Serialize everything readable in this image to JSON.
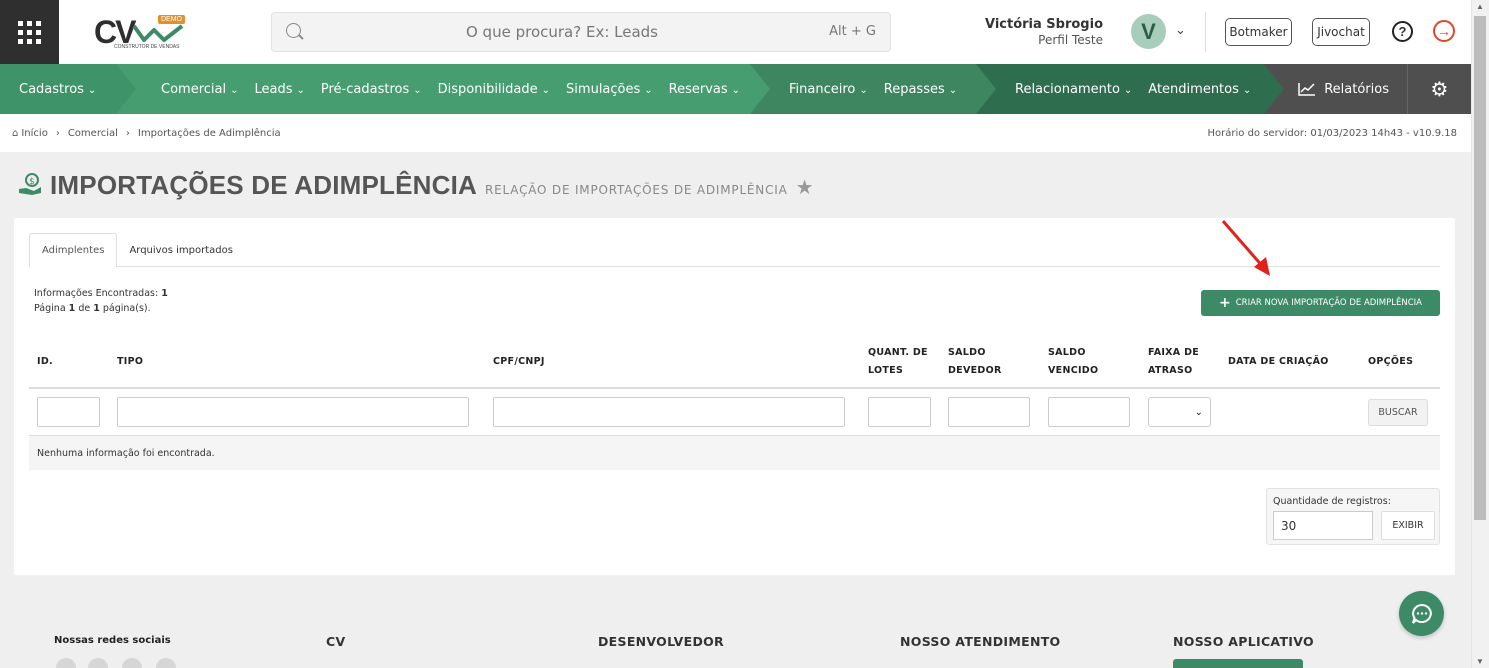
{
  "header": {
    "logo_text": "CV",
    "logo_badge": "DEMO",
    "logo_tagline": "CONSTRUTOR DE VENDAS",
    "search_placeholder": "O que procura? Ex: Leads",
    "search_shortcut": "Alt + G",
    "user_name": "Victória Sbrogio",
    "user_profile": "Perfil Teste",
    "avatar_letter": "V",
    "botmaker_label": "Botmaker",
    "jivochat_label": "Jivochat",
    "help_symbol": "?"
  },
  "nav": {
    "groups": [
      {
        "color": "#3e9468",
        "items": [
          "Cadastros"
        ]
      },
      {
        "color": "#469d70",
        "items": [
          "Comercial",
          "Leads",
          "Pré-cadastros",
          "Disponibilidade",
          "Simulações",
          "Reservas"
        ]
      },
      {
        "color": "#3d8660",
        "items": [
          "Financeiro",
          "Repasses"
        ]
      },
      {
        "color": "#2f6d4f",
        "items": [
          "Relacionamento",
          "Atendimentos"
        ]
      }
    ],
    "reports_label": "Relatórios"
  },
  "breadcrumb": {
    "items": [
      "Início",
      "Comercial",
      "Importações de Adimplência"
    ],
    "server_time": "Horário do servidor: 01/03/2023 14h43 - v10.9.18"
  },
  "page": {
    "title": "IMPORTAÇÕES DE ADIMPLÊNCIA",
    "subtitle": "RELAÇÃO DE IMPORTAÇÕES DE ADIMPLÊNCIA"
  },
  "tabs": [
    {
      "label": "Adimplentes",
      "active": true
    },
    {
      "label": "Arquivos importados",
      "active": false
    }
  ],
  "info": {
    "found_label": "Informações Encontradas:",
    "found_count": "1",
    "page_prefix": "Página",
    "page_current": "1",
    "page_of": "de",
    "page_total": "1",
    "page_suffix": "página(s)."
  },
  "create_button_label": "CRIAR NOVA IMPORTAÇÃO DE ADIMPLÊNCIA",
  "table": {
    "headers": {
      "id": "ID.",
      "tipo": "TIPO",
      "cpf": "CPF/CNPJ",
      "quant_1": "QUANT. DE",
      "quant_2": "LOTES",
      "saldo_dev_1": "SALDO",
      "saldo_dev_2": "DEVEDOR",
      "saldo_ven_1": "SALDO",
      "saldo_ven_2": "VENCIDO",
      "faixa_1": "FAIXA DE",
      "faixa_2": "ATRASO",
      "data": "DATA DE CRIAÇÃO",
      "opcoes": "OPÇÕES"
    },
    "search_button": "BUSCAR",
    "empty_message": "Nenhuma informação foi encontrada."
  },
  "pagination": {
    "qty_label": "Quantidade de registros:",
    "qty_value": "30",
    "show_button": "EXIBIR"
  },
  "footer": {
    "social": "Nossas redes sociais",
    "cv": "CV",
    "dev": "DESENVOLVEDOR",
    "support": "NOSSO ATENDIMENTO",
    "app": "NOSSO APLICATIVO"
  },
  "colors": {
    "brand_green": "#3d8a67",
    "annotation_red": "#e3211c",
    "reports_bg": "#4f4f4f"
  }
}
